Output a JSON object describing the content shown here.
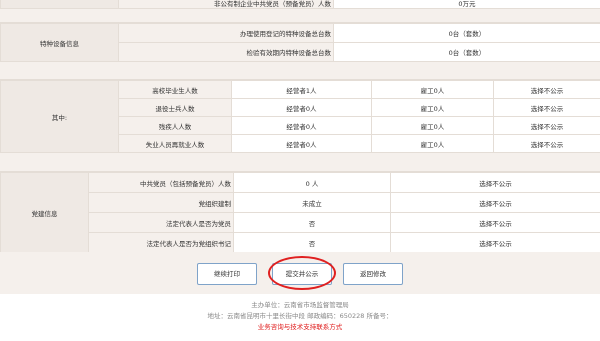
{
  "top": {
    "label": "非公有制企业中共党员（预备党员）人数",
    "value": "0万元"
  },
  "equipment": {
    "section": "特种设备信息",
    "rows": [
      {
        "label": "办理使用登记的特种设备总台数",
        "value": "0台（套数）"
      },
      {
        "label": "检验有效期内特种设备总台数",
        "value": "0台（套数）"
      }
    ]
  },
  "employment": {
    "section": "其中:",
    "rows": [
      {
        "label": "高校毕业生人数",
        "op": "经营者1人",
        "emp": "雇工0人",
        "pub": "选择不公示"
      },
      {
        "label": "退役士兵人数",
        "op": "经营者0人",
        "emp": "雇工0人",
        "pub": "选择不公示"
      },
      {
        "label": "残疾人人数",
        "op": "经营者0人",
        "emp": "雇工0人",
        "pub": "选择不公示"
      },
      {
        "label": "失业人员再就业人数",
        "op": "经营者0人",
        "emp": "雇工0人",
        "pub": "选择不公示"
      }
    ]
  },
  "party": {
    "section": "党建信息",
    "rows": [
      {
        "label": "中共党员（包括预备党员）人数",
        "value": "0 人",
        "pub": "选择不公示"
      },
      {
        "label": "党组织建制",
        "value": "未成立",
        "pub": "选择不公示"
      },
      {
        "label": "法定代表人是否为党员",
        "value": "否",
        "pub": "选择不公示"
      },
      {
        "label": "法定代表人是否为党组织书记",
        "value": "否",
        "pub": "选择不公示"
      }
    ]
  },
  "buttons": {
    "print": "继续打印",
    "submit": "提交并公示",
    "back": "返回修改"
  },
  "footer": {
    "sponsor": "主办单位：云南省市场监督管理局",
    "address": "地址：云南省昆明市十里长街中段 邮政编码：650228 所备号：",
    "contact": "业务咨询与技术支持联系方式"
  }
}
